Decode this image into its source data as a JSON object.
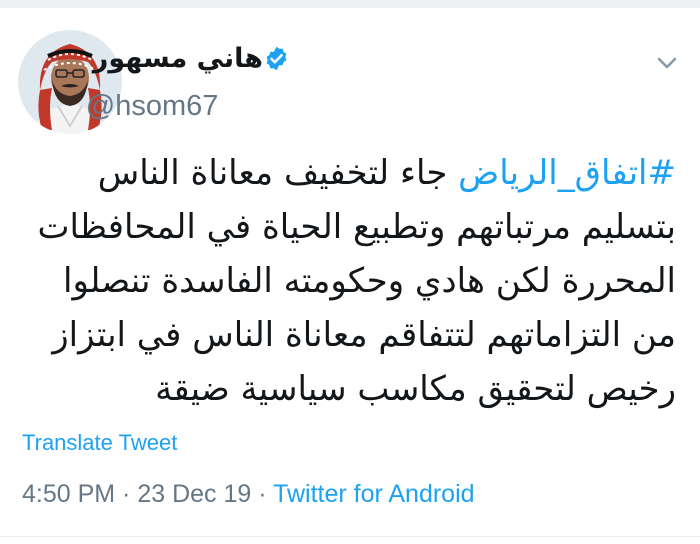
{
  "author": {
    "display_name": "هاني مسهور",
    "handle": "@hsom67",
    "verified": true,
    "verified_icon": "verified-badge-icon"
  },
  "tweet": {
    "hashtag": "#اتفاق_الرياض",
    "text": " جاء لتخفيف معاناة الناس بتسليم مرتباتهم وتطبيع الحياة في المحافظات المحررة لكن هادي وحكومته الفاسدة تنصلوا من التزاماتهم لتتفاقم معاناة الناس في ابتزاز رخيص لتحقيق مكاسب سياسية ضيقة"
  },
  "translate_label": "Translate Tweet",
  "meta": {
    "time": "4:50 PM",
    "separator": " · ",
    "date": "23 Dec 19",
    "source": "Twitter for Android"
  },
  "colors": {
    "accent": "#1da1f2",
    "text": "#14171a",
    "muted": "#657786"
  }
}
